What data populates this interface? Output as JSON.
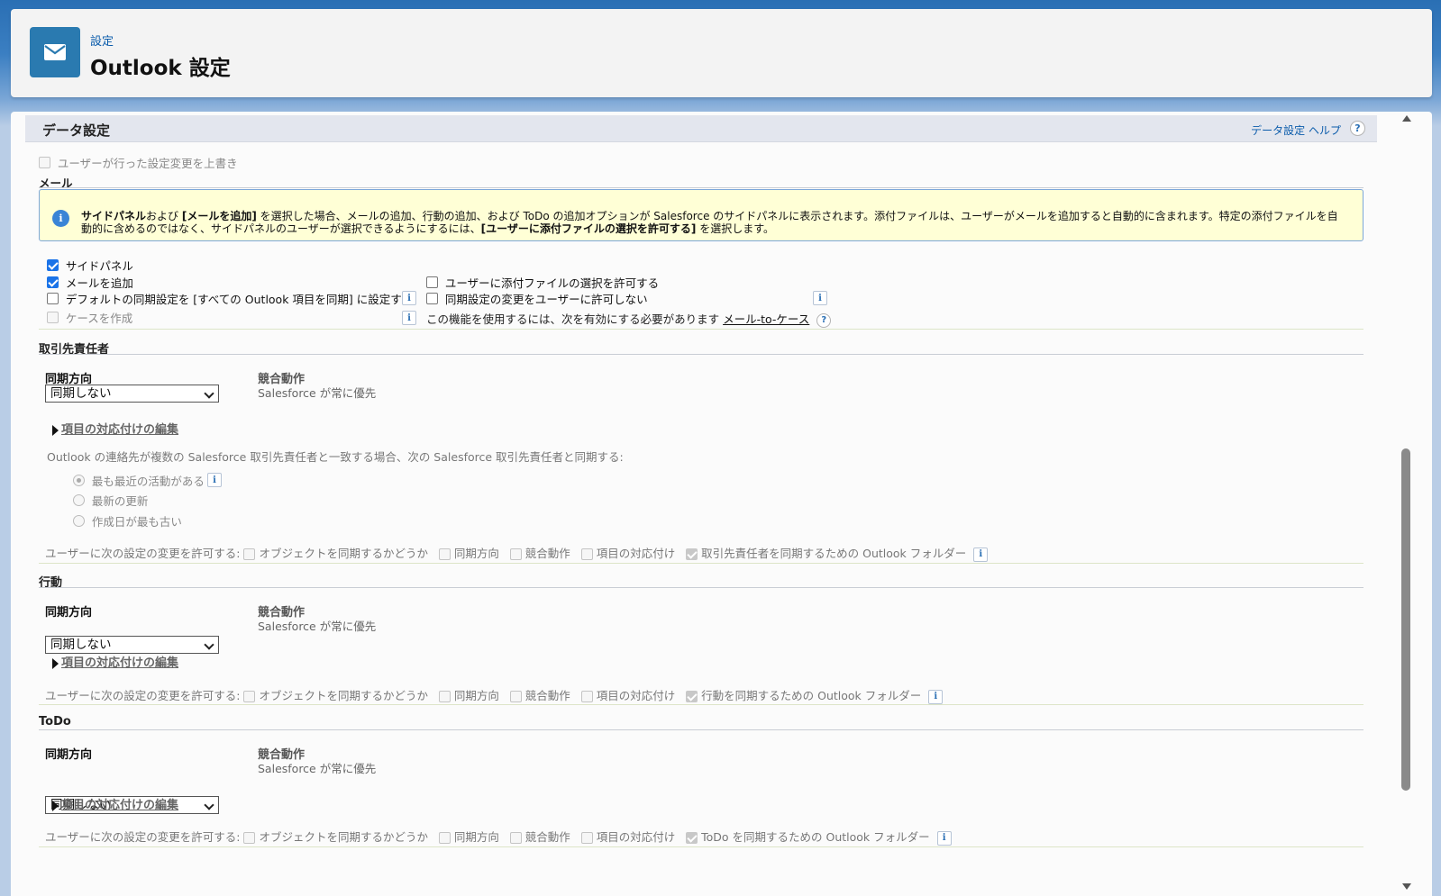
{
  "header": {
    "breadcrumb": "設定",
    "title": "Outlook 設定",
    "icon": "mail-icon"
  },
  "section": {
    "title": "データ設定",
    "help_label": "データ設定 ヘルプ",
    "help_icon": "?"
  },
  "override_label": "ユーザーが行った設定変更を上書き",
  "mail": {
    "heading": "メール",
    "info": {
      "b1": "サイドパネル",
      "t1": "および ",
      "b2": "[メールを追加]",
      "t2": " を選択した場合、メールの追加、行動の追加、および ToDo の追加オプションが Salesforce のサイドパネルに表示されます。添付ファイルは、ユーザーがメールを追加すると自動的に含まれます。特定の添付ファイルを自動的に含めるのではなく、サイドパネルのユーザーが選択できるようにするには、",
      "b3": "[ユーザーに添付ファイルの選択を許可する]",
      "t3": " を選択します。"
    },
    "side_panel": "サイドパネル",
    "add_email": "メールを追加",
    "default_sync": "デフォルトの同期設定を [すべての Outlook 項目を同期] に設定する",
    "create_case": "ケースを作成",
    "allow_attach": "ユーザーに添付ファイルの選択を許可する",
    "disallow_sync_change": "同期設定の変更をユーザーに許可しない",
    "case_req_prefix": "この機能を使用するには、次を有効にする必要があります ",
    "case_req_link": "メール-to-ケース",
    "info_glyph": "i"
  },
  "contacts": {
    "heading": "取引先責任者",
    "sync_dir_label": "同期方向",
    "sync_dir_value": "同期しない",
    "conflict_label": "競合動作",
    "conflict_value": "Salesforce が常に優先",
    "edit_mapping": "項目の対応付けの編集",
    "multi_match_text": "Outlook の連絡先が複数の Salesforce 取引先責任者と一致する場合、次の Salesforce 取引先責任者と同期する:",
    "radio_recent_activity": "最も最近の活動がある",
    "radio_latest_update": "最新の更新",
    "radio_oldest_created": "作成日が最も古い",
    "allow_prefix": "ユーザーに次の設定の変更を許可する:",
    "allow_object_sync": "オブジェクトを同期するかどうか",
    "allow_sync_dir": "同期方向",
    "allow_conflict": "競合動作",
    "allow_mapping": "項目の対応付け",
    "allow_folder": "取引先責任者を同期するための Outlook フォルダー"
  },
  "events": {
    "heading": "行動",
    "sync_dir_label": "同期方向",
    "sync_dir_value": "同期しない",
    "conflict_label": "競合動作",
    "conflict_value": "Salesforce が常に優先",
    "edit_mapping": "項目の対応付けの編集",
    "allow_prefix": "ユーザーに次の設定の変更を許可する:",
    "allow_object_sync": "オブジェクトを同期するかどうか",
    "allow_sync_dir": "同期方向",
    "allow_conflict": "競合動作",
    "allow_mapping": "項目の対応付け",
    "allow_folder": "行動を同期するための Outlook フォルダー"
  },
  "todo": {
    "heading": "ToDo",
    "sync_dir_label": "同期方向",
    "sync_dir_value": "同期しない",
    "conflict_label": "競合動作",
    "conflict_value": "Salesforce が常に優先",
    "edit_mapping": "項目の対応付けの編集",
    "allow_prefix": "ユーザーに次の設定の変更を許可する:",
    "allow_object_sync": "オブジェクトを同期するかどうか",
    "allow_sync_dir": "同期方向",
    "allow_conflict": "競合動作",
    "allow_mapping": "項目の対応付け",
    "allow_folder": "ToDo を同期するための Outlook フォルダー"
  },
  "colors": {
    "accent": "#0b5cab",
    "header_icon_bg": "#2a7ab0",
    "info_bg": "#ffffd6",
    "checkbox_checked": "#1a73e8"
  }
}
